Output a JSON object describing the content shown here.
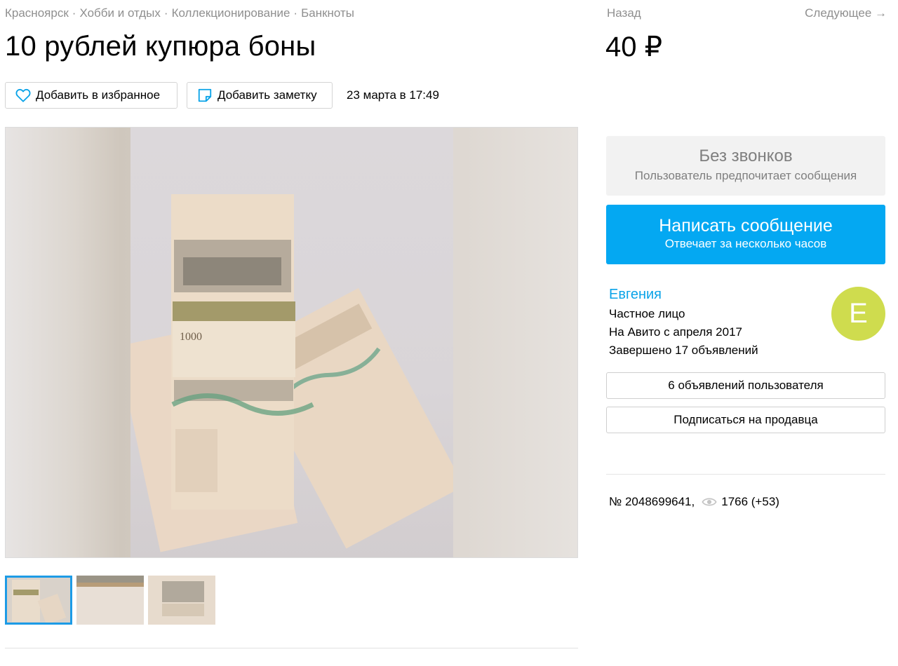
{
  "breadcrumbs": [
    "Красноярск",
    "Хобби и отдых",
    "Коллекционирование",
    "Банкноты"
  ],
  "breadcrumb_separator": "·",
  "nav": {
    "back": "Назад",
    "next": "Следующее →"
  },
  "listing": {
    "title": "10 рублей купюра боны",
    "price": "40 ₽",
    "date": "23 марта в 17:49",
    "number": "№ 2048699641,",
    "views": "1766 (+53)"
  },
  "actions": {
    "favorite": "Добавить в избранное",
    "note": "Добавить заметку"
  },
  "contact": {
    "no_calls_title": "Без звонков",
    "no_calls_subtitle": "Пользователь предпочитает сообщения",
    "message_title": "Написать сообщение",
    "message_subtitle": "Отвечает за несколько часов"
  },
  "seller": {
    "name": "Евгения",
    "type": "Частное лицо",
    "since": "На Авито с апреля 2017",
    "completed": "Завершено 17 объявлений",
    "avatar_letter": "Е",
    "ads_button": "6 объявлений пользователя",
    "subscribe_button": "Подписаться на продавца"
  },
  "colors": {
    "accent": "#04a8f2",
    "link": "#0aa3e8",
    "avatar": "#cfdc4e",
    "muted": "#8f8f8f"
  },
  "icons": {
    "favorite": "heart-icon",
    "note": "note-icon",
    "views": "eye-icon"
  }
}
